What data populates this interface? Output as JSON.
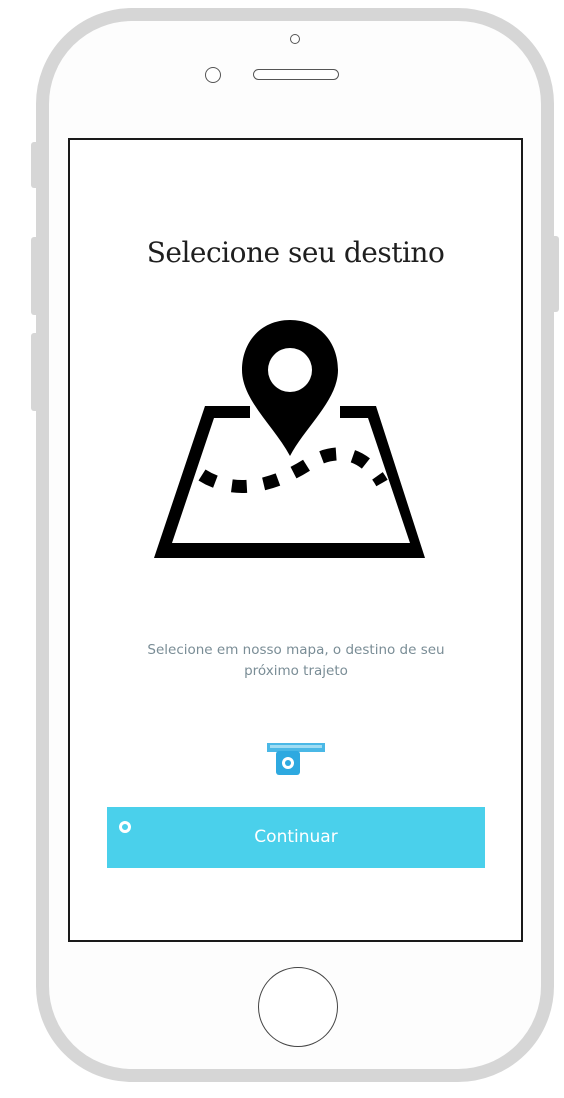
{
  "screen": {
    "title": "Selecione seu destino",
    "illustration_icon": "map-pin-route-icon",
    "description_lines": [
      "Selecione em nosso mapa, o destino de seu",
      "próximo trajeto"
    ],
    "secondary_icon": "ticket-camera-icon",
    "continue_button_label": "Continuar"
  },
  "colors": {
    "accent": "#4ad0eb",
    "title_text": "#1f1f1f",
    "description_text": "#7a8d96",
    "device_frame": "#d6d6d6"
  }
}
